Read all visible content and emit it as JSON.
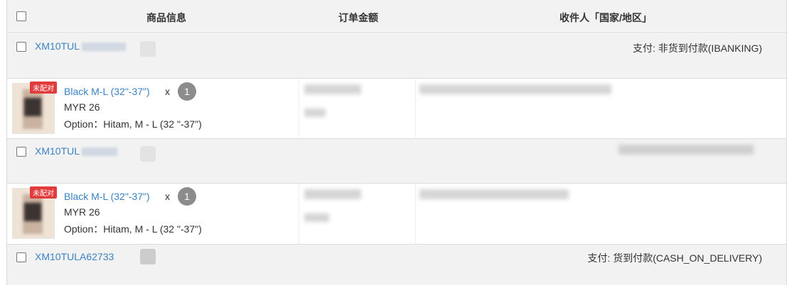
{
  "header": {
    "product_info": "商品信息",
    "order_amount": "订单金额",
    "recipient": "收件人「国家/地区」"
  },
  "orders": [
    {
      "order_no": "XM10TUL",
      "payment": "支付: 非货到付款(IBANKING)",
      "item": {
        "badge": "未配对",
        "name": "Black M-L (32\"-37\")",
        "times": "x",
        "qty": "1",
        "price": "MYR 26",
        "option": "Option：Hitam, M - L (32 \"-37\")"
      }
    },
    {
      "order_no": "XM10TUL",
      "payment": "",
      "item": {
        "badge": "未配对",
        "name": "Black M-L (32\"-37\")",
        "times": "x",
        "qty": "1",
        "price": "MYR 26",
        "option": "Option：Hitam, M - L (32 \"-37\")"
      }
    },
    {
      "order_no": "XM10TULA62733",
      "payment": "支付: 货到付款(CASH_ON_DELIVERY)"
    }
  ]
}
